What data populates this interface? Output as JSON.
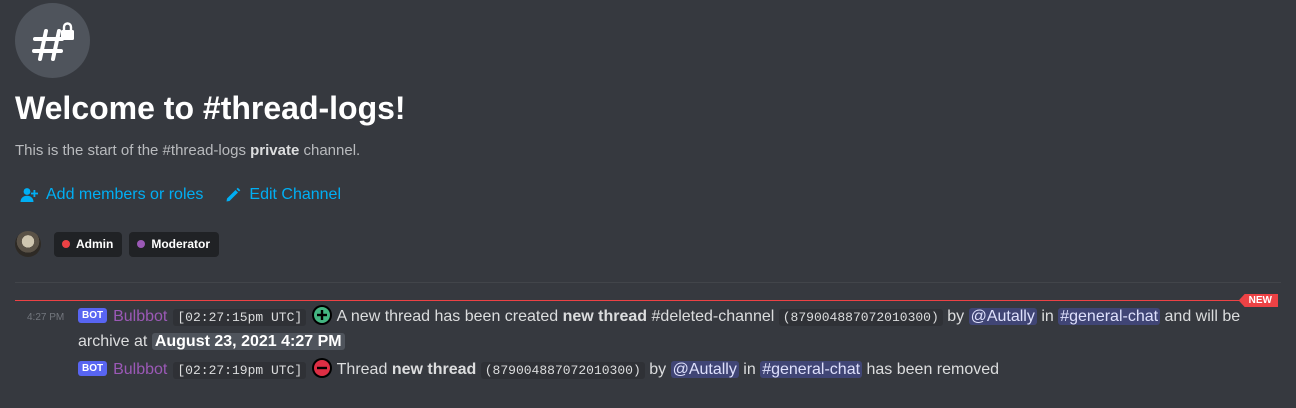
{
  "header": {
    "icon": "hash-lock-icon",
    "title": "Welcome to #thread-logs!",
    "subtitle_prefix": "This is the start of the #thread-logs",
    "subtitle_bold": "private",
    "subtitle_suffix": "channel."
  },
  "actions": {
    "add_members": "Add members or roles",
    "edit_channel": "Edit Channel"
  },
  "roles": [
    {
      "name": "Admin",
      "color": "#ed4245"
    },
    {
      "name": "Moderator",
      "color": "#9b59b6"
    }
  ],
  "new_badge": "NEW",
  "messages": [
    {
      "timestamp": "4:27 PM",
      "bot_tag": "BOT",
      "author": "Bulbbot",
      "time_code": "[02:27:15pm UTC]",
      "emoji": "plus-icon",
      "text_a": "A new thread has been created",
      "thread_name": "new thread",
      "deleted_channel": "#deleted-channel",
      "thread_id": "(879004887072010300)",
      "by": "by",
      "user": "@Autally",
      "in": "in",
      "channel": "#general-chat",
      "tail": "and will be archive at",
      "archive_date": "August 23, 2021 4:27 PM"
    },
    {
      "bot_tag": "BOT",
      "author": "Bulbbot",
      "time_code": "[02:27:19pm UTC]",
      "emoji": "minus-icon",
      "text_a": "Thread",
      "thread_name": "new thread",
      "thread_id": "(879004887072010300)",
      "by": "by",
      "user": "@Autally",
      "in": "in",
      "channel": "#general-chat",
      "tail": "has been removed"
    }
  ],
  "colors": {
    "background": "#36393f",
    "link": "#00aff4",
    "bot_tag": "#5865f2",
    "author": "#9b59b6",
    "new_divider": "#ed4245"
  }
}
